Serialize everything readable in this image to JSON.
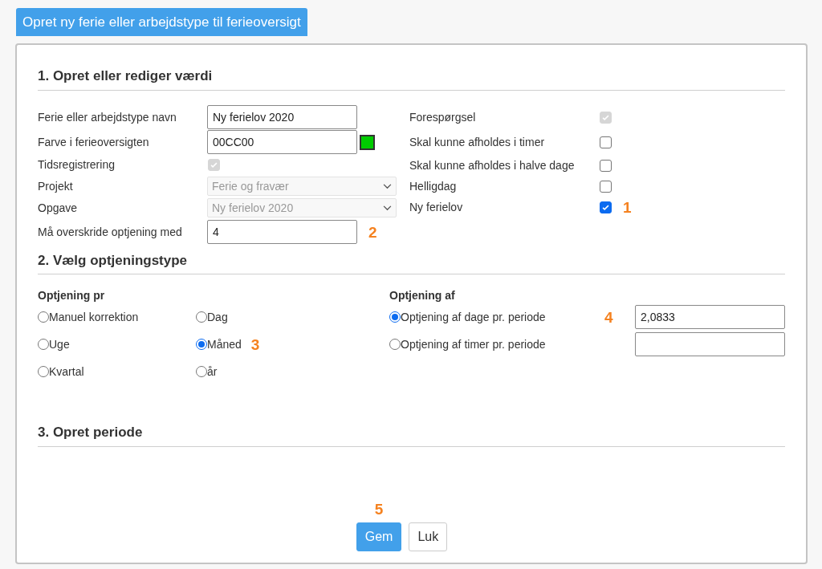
{
  "header_tab": {
    "title": "Opret ny ferie eller arbejdstype til ferieoversigt"
  },
  "section_1": {
    "title": "1. Opret eller rediger værdi",
    "left_fields": [
      {
        "kind": "text",
        "label": "Ferie eller arbejdstype navn",
        "value": "Ny ferielov 2020"
      },
      {
        "kind": "color",
        "label": "Farve i ferieoversigten",
        "value": "00CC00",
        "color": "#00cc00"
      },
      {
        "kind": "checkbox",
        "label": "Tidsregistrering",
        "checked": true,
        "disabled": true
      },
      {
        "kind": "select",
        "label": "Projekt",
        "value": "Ferie og fravær",
        "disabled": true
      },
      {
        "kind": "select",
        "label": "Opgave",
        "value": "Ny ferielov 2020",
        "disabled": true
      },
      {
        "kind": "text",
        "label": "Må overskride optjening med",
        "value": "4",
        "marker": "2"
      }
    ],
    "right_fields": [
      {
        "label": "Forespørgsel",
        "checked": true,
        "disabled": true
      },
      {
        "label": "Skal kunne afholdes i timer",
        "checked": false,
        "disabled": false
      },
      {
        "label": "Skal kunne afholdes i halve dage",
        "checked": false,
        "disabled": false
      },
      {
        "label": "Helligdag",
        "checked": false,
        "disabled": false
      },
      {
        "label": "Ny ferielov",
        "checked": true,
        "disabled": false,
        "marker": "1"
      }
    ]
  },
  "section_2": {
    "title": "2. Vælg optjeningstype",
    "per": {
      "heading": "Optjening pr",
      "options": [
        {
          "label": "Manuel korrektion",
          "selected": false
        },
        {
          "label": "Dag",
          "selected": false
        },
        {
          "label": "Uge",
          "selected": false
        },
        {
          "label": "Måned",
          "selected": true,
          "marker": "3"
        },
        {
          "label": "Kvartal",
          "selected": false
        },
        {
          "label": "år",
          "selected": false
        }
      ]
    },
    "of": {
      "heading": "Optjening af",
      "options": [
        {
          "label": "Optjening af dage pr. periode",
          "selected": true,
          "value": "2,0833",
          "marker": "4"
        },
        {
          "label": "Optjening af timer pr. periode",
          "selected": false
        }
      ]
    }
  },
  "section_3": {
    "title": "3. Opret periode"
  },
  "buttons": [
    {
      "label": "Gem",
      "kind": "primary",
      "marker": "5"
    },
    {
      "label": "Luk",
      "kind": "secondary"
    }
  ]
}
